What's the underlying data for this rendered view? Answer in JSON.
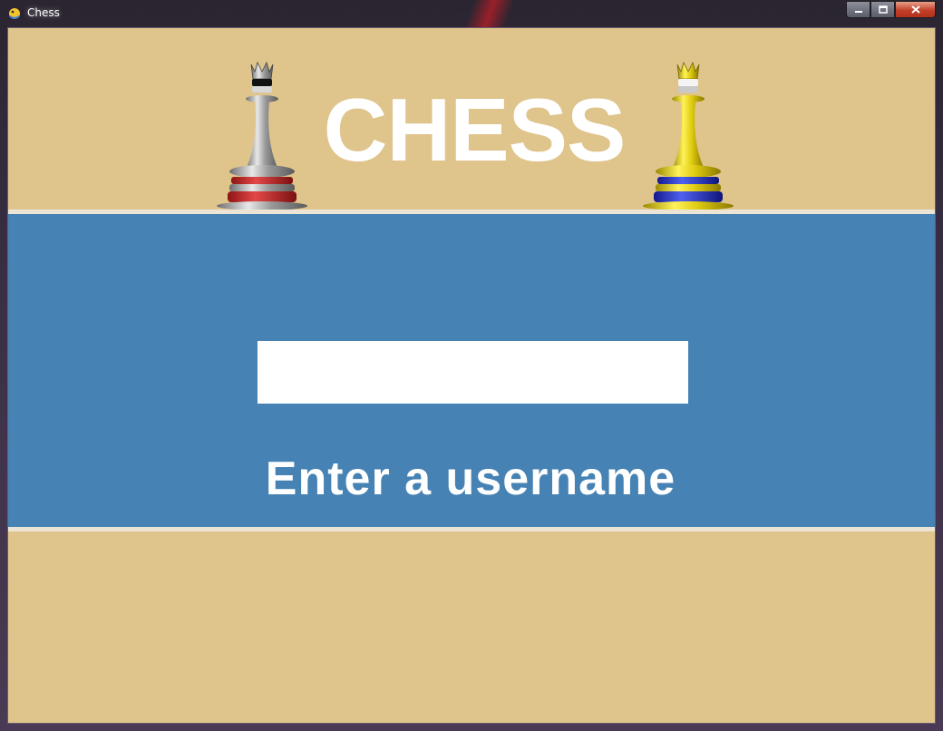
{
  "window": {
    "title": "Chess",
    "app_icon": "pygame-snake-icon",
    "buttons": {
      "minimize": "minimize-icon",
      "maximize": "maximize-icon",
      "close": "close-icon"
    }
  },
  "header": {
    "title": "CHESS",
    "left_piece": "black-queen-icon",
    "right_piece": "white-queen-icon"
  },
  "login": {
    "prompt": "Enter a username",
    "username_value": "",
    "username_placeholder": ""
  },
  "colors": {
    "tan": "#dfc48c",
    "blue": "#4682b4",
    "separator": "#ece5d6",
    "text": "#ffffff",
    "input_bg": "#ffffff"
  }
}
